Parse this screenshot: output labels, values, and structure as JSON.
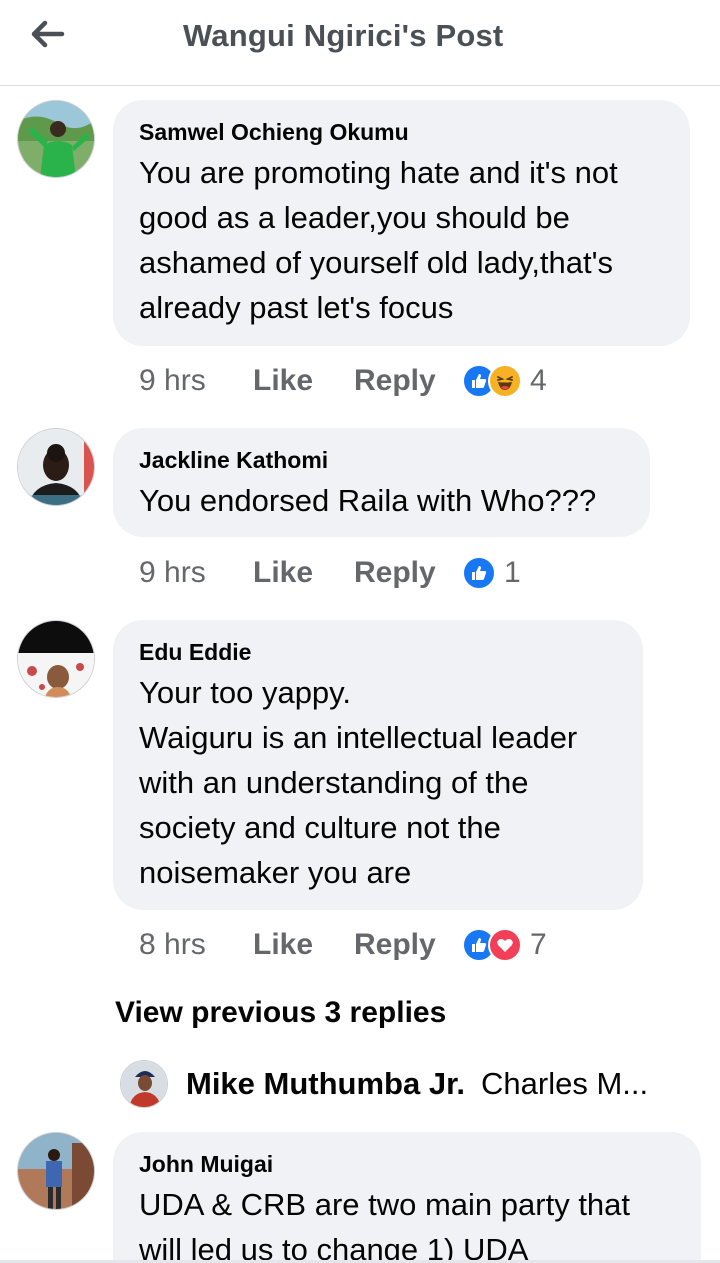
{
  "header": {
    "title": "Wangui Ngirici's Post"
  },
  "comments": [
    {
      "author": "Samwel Ochieng Okumu",
      "text": "You are promoting hate and it's not\ngood as a leader,you should be\nashamed of yourself old lady,that's\nalready past let's focus",
      "time": "9 hrs",
      "like": "Like",
      "reply": "Reply",
      "reactions": [
        "like-icon",
        "haha-icon"
      ],
      "reaction_count": "4"
    },
    {
      "author": "Jackline Kathomi",
      "text": "You endorsed Raila with Who???",
      "time": "9 hrs",
      "like": "Like",
      "reply": "Reply",
      "reactions": [
        "like-icon"
      ],
      "reaction_count": "1"
    },
    {
      "author": "Edu Eddie",
      "text": "Your too yappy.\nWaiguru is an intellectual leader\nwith an understanding of the\nsociety and culture not the\nnoisemaker you are",
      "time": "8 hrs",
      "like": "Like",
      "reply": "Reply",
      "reactions": [
        "like-icon",
        "love-icon"
      ],
      "reaction_count": "7"
    },
    {
      "author": "John Muigai",
      "text": "UDA & CRB are two main party that\nwill led us to change 1) UDA"
    }
  ],
  "view_previous": "View previous 3 replies",
  "reply_preview": {
    "author": "Mike Muthumba Jr.",
    "text": "Charles M..."
  },
  "colors": {
    "like_blue": "#1877f2",
    "love_red": "#f33e58",
    "haha_yellow": "#f7b125",
    "bubble_bg": "#f0f2f5",
    "meta_gray": "#65676b"
  }
}
